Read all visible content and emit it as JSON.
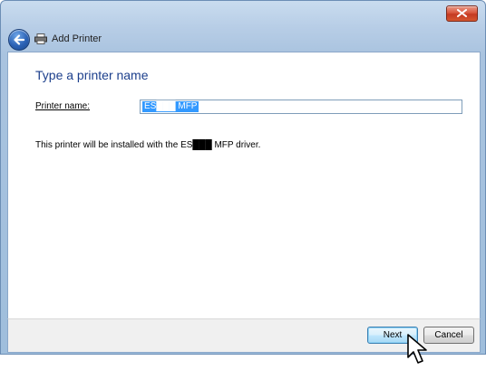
{
  "window": {
    "title": "Add Printer"
  },
  "page": {
    "heading": "Type a printer name",
    "printer_name_label": "Printer name:",
    "printer_name_value": "ES███ MFP",
    "info_text": "This printer will be installed with the ES███ MFP driver."
  },
  "buttons": {
    "next": "Next",
    "cancel": "Cancel"
  },
  "colors": {
    "heading": "#1c3f8c",
    "selection": "#3399ff",
    "close_button": "#c53a22"
  }
}
